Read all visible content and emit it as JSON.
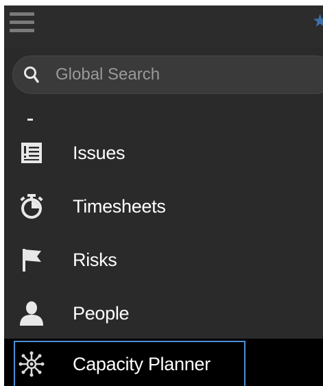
{
  "header": {
    "menu_icon": "hamburger-menu-icon",
    "star_icon": "star-icon",
    "accent_color": "#3e6fa8"
  },
  "search": {
    "icon": "search-icon",
    "placeholder": "Global Search",
    "value": ""
  },
  "nav": {
    "items": [
      {
        "label": "Issues",
        "icon": "issues-icon"
      },
      {
        "label": "Timesheets",
        "icon": "stopwatch-icon"
      },
      {
        "label": "Risks",
        "icon": "flag-icon"
      },
      {
        "label": "People",
        "icon": "person-icon"
      },
      {
        "label": "Capacity Planner",
        "icon": "capacity-planner-icon",
        "active": true
      }
    ]
  },
  "colors": {
    "panel_background": "#2a2a2a",
    "active_background": "#000000",
    "active_outline": "#4a90d9",
    "text": "#ffffff"
  }
}
